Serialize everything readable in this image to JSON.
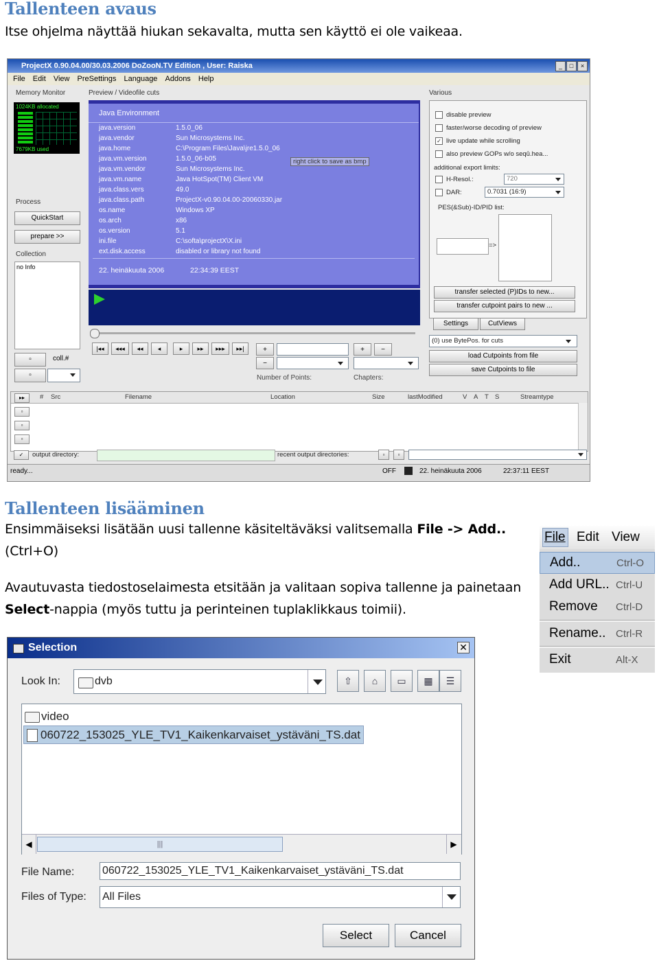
{
  "section1": {
    "heading": "Tallenteen avaus",
    "text": "Itse ohjelma näyttää hiukan sekavalta, mutta sen käyttö ei ole vaikeaa."
  },
  "projectx": {
    "title": "ProjectX 0.90.04.00/30.03.2006 DoZooN.TV Edition , User: Raiska",
    "menu": [
      "File",
      "Edit",
      "View",
      "PreSettings",
      "Language",
      "Addons",
      "Help"
    ],
    "memory_monitor": "Memory Monitor",
    "mem_allocated": "1024KB allocated",
    "mem_used": "7679KB used",
    "preview_label": "Preview / Videofile cuts",
    "various_label": "Various",
    "java_env_title": "Java Environment",
    "java_env": [
      [
        "java.version",
        "1.5.0_06"
      ],
      [
        "java.vendor",
        "Sun Microsystems Inc."
      ],
      [
        "java.home",
        "C:\\Program Files\\Java\\jre1.5.0_06"
      ],
      [
        "java.vm.version",
        "1.5.0_06-b05"
      ],
      [
        "java.vm.vendor",
        "Sun Microsystems Inc."
      ],
      [
        "java.vm.name",
        "Java HotSpot(TM) Client VM"
      ],
      [
        "java.class.vers",
        "49.0"
      ],
      [
        "java.class.path",
        "ProjectX-v0.90.04.00-20060330.jar"
      ],
      [
        "os.name",
        "Windows XP"
      ],
      [
        "os.arch",
        "x86"
      ],
      [
        "os.version",
        "5.1"
      ],
      [
        "ini.file",
        "C:\\softa\\projectX\\X.ini"
      ],
      [
        "ext.disk.access",
        "disabled or library not found"
      ]
    ],
    "tooltip": "right click to save as bmp",
    "java_date": "22. heinäkuuta 2006",
    "java_time": "22:34:39 EEST",
    "process_label": "Process",
    "quickstart": "QuickStart",
    "prepare": "prepare >>",
    "collection_label": "Collection",
    "no_info": "no Info",
    "coll": "coll.#",
    "options": [
      {
        "label": "disable preview",
        "checked": false
      },
      {
        "label": "faster/worse decoding of preview",
        "checked": false
      },
      {
        "label": "live update while scrolling",
        "checked": true
      },
      {
        "label": "also preview GOPs w/o seqû.hea...",
        "checked": false
      }
    ],
    "export_limits": "additional export limits:",
    "hresol_label": "H-Resol.:",
    "hresol_value": "720",
    "dar_label": "DAR:",
    "dar_value": "0.7031 (16:9)",
    "pid_label": "PES(&Sub)-ID/PID list:",
    "transfer_pids": "transfer selected (P)IDs to new...",
    "transfer_cuts": "transfer cutpoint pairs to new ...",
    "tabs": [
      "Settings",
      "CutViews"
    ],
    "cut_mode": "(0) use BytePos. for cuts",
    "load_cuts": "load Cutpoints from file",
    "save_cuts": "save Cutpoints to file",
    "number_of_points": "Number of Points:",
    "chapters": "Chapters:",
    "table_headers": [
      "#",
      "Src",
      "Filename",
      "Location",
      "Size",
      "lastModified",
      "V",
      "A",
      "T",
      "S",
      "Streamtype"
    ],
    "output_directory": "output directory:",
    "recent_output": "recent output directories:",
    "status": "ready...",
    "off": "OFF",
    "status_date": "22. heinäkuuta 2006",
    "status_time": "22:37:11 EEST"
  },
  "section2": {
    "heading": "Tallenteen lisääminen",
    "p1_pre": "Ensimmäiseksi lisätään uusi tallenne käsiteltäväksi valitsemalla ",
    "p1_bold": "File -> Add..",
    "p1_post": "(Ctrl+O)",
    "p2_line1": "Avautuvasta tiedostoselaimesta etsitään ja valitaan sopiva tallenne ja painetaan",
    "p2_bold": "Select",
    "p2_rest": "-nappia (myös tuttu ja perinteinen tuplaklikkaus toimii)."
  },
  "file_menu": {
    "menubar": [
      "File",
      "Edit",
      "View"
    ],
    "items": [
      {
        "label": "Add..",
        "shortcut": "Ctrl-O",
        "highlighted": true
      },
      {
        "label": "Add URL..",
        "shortcut": "Ctrl-U",
        "highlighted": false
      },
      {
        "label": "Remove",
        "shortcut": "Ctrl-D",
        "highlighted": false
      },
      {
        "label": "Rename..",
        "shortcut": "Ctrl-R",
        "highlighted": false
      },
      {
        "label": "Exit",
        "shortcut": "Alt-X",
        "highlighted": false
      }
    ]
  },
  "selection_dialog": {
    "title": "Selection",
    "look_in_label": "Look In:",
    "look_in_value": "dvb",
    "files": [
      {
        "name": "video",
        "type": "folder",
        "selected": false
      },
      {
        "name": "060722_153025_YLE_TV1_Kaikenkarvaiset_ystäväni_TS.dat",
        "type": "file",
        "selected": true
      }
    ],
    "file_name_label": "File Name:",
    "file_name_value": "060722_153025_YLE_TV1_Kaikenkarvaiset_ystäväni_TS.dat",
    "files_of_type_label": "Files of Type:",
    "files_of_type_value": "All Files",
    "select_button": "Select",
    "cancel_button": "Cancel"
  },
  "colors": {
    "heading": "#4f81bd",
    "java_panel": "#7b7fe0",
    "title_bar": "#1a4fb0",
    "menu_highlight": "#b8cce4"
  }
}
